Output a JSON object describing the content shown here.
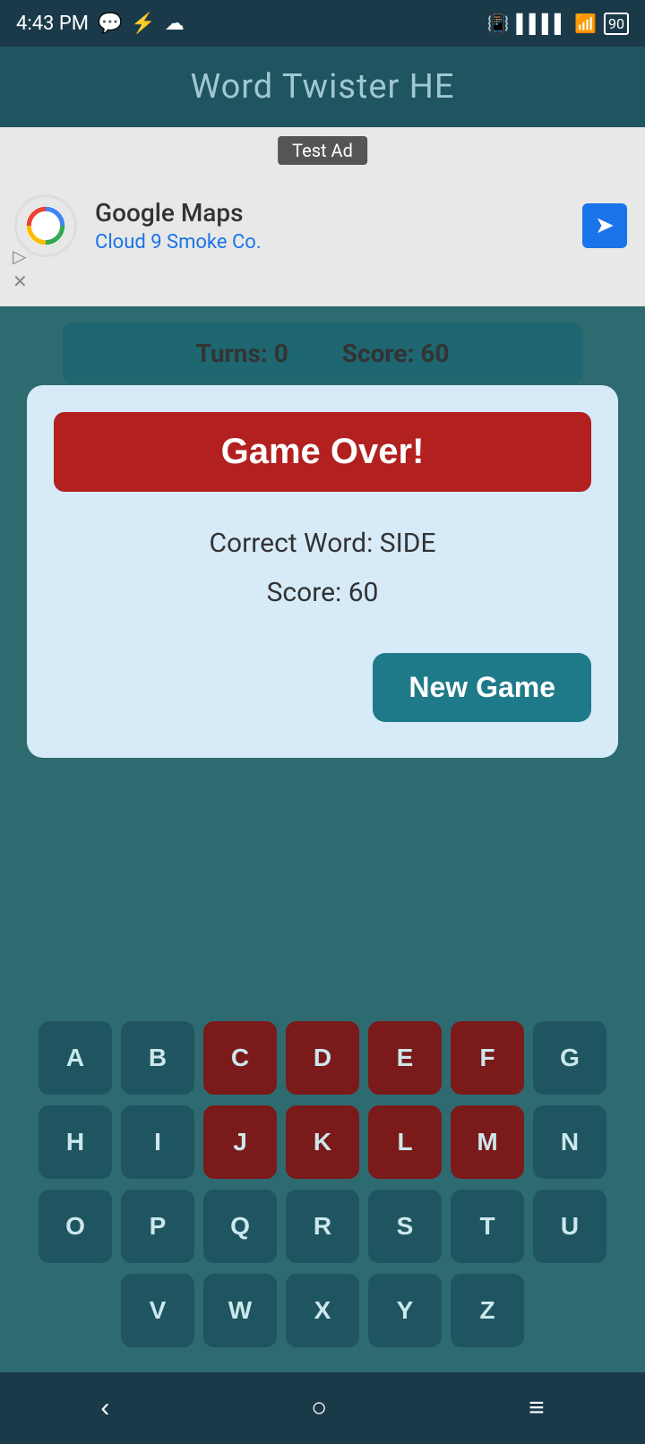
{
  "statusBar": {
    "time": "4:43 PM",
    "battery": "90"
  },
  "header": {
    "title": "Word Twister HE"
  },
  "ad": {
    "label": "Test Ad",
    "company": "Google Maps",
    "subtitle": "Cloud 9 Smoke Co."
  },
  "scoreBar": {
    "turnsLabel": "Turns:",
    "turnsValue": "0",
    "scoreLabel": "Score:",
    "scoreValue": "60"
  },
  "dialog": {
    "gameOverLabel": "Game Over!",
    "correctWordLabel": "Correct Word: SIDE",
    "scoreLabel": "Score: 60",
    "newGameLabel": "New Game"
  },
  "keyboard": {
    "rows": [
      [
        "A",
        "B",
        "C",
        "D",
        "E",
        "F",
        "G"
      ],
      [
        "H",
        "I",
        "J",
        "K",
        "L",
        "M",
        "N"
      ],
      [
        "O",
        "P",
        "Q",
        "R",
        "S",
        "T",
        "U"
      ],
      [
        "V",
        "W",
        "X",
        "Y",
        "Z"
      ]
    ],
    "usedKeys": [
      "C",
      "D",
      "E",
      "F",
      "J",
      "K",
      "L",
      "M"
    ]
  },
  "navBar": {
    "backLabel": "‹",
    "homeLabel": "○",
    "menuLabel": "≡"
  }
}
